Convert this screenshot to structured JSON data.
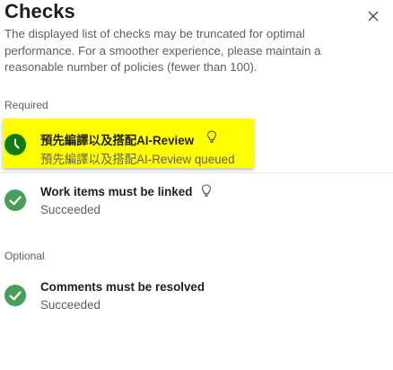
{
  "panel": {
    "title": "Checks",
    "description": "The displayed list of checks may be truncated for optimal performance. For a smoother experience, please maintain a reasonable number of policies (fewer than 100).",
    "close_icon": "close-icon"
  },
  "sections": {
    "required_label": "Required",
    "optional_label": "Optional"
  },
  "checks": {
    "required": [
      {
        "name": "預先編譯以及搭配AI-Review",
        "status": "預先編譯以及搭配AI-Review queued",
        "state_icon": "clock-icon",
        "hint_icon": "lightbulb-icon",
        "highlighted": true
      },
      {
        "name": "Work items must be linked",
        "status": "Succeeded",
        "state_icon": "checkmark-icon",
        "hint_icon": "lightbulb-icon"
      }
    ],
    "optional": [
      {
        "name": "Comments must be resolved",
        "status": "Succeeded",
        "state_icon": "checkmark-icon"
      }
    ]
  },
  "colors": {
    "queued_green": "#107c10",
    "success_green": "#4a9e5c",
    "highlight": "#ffff00",
    "secondary_text": "#605e5c"
  }
}
